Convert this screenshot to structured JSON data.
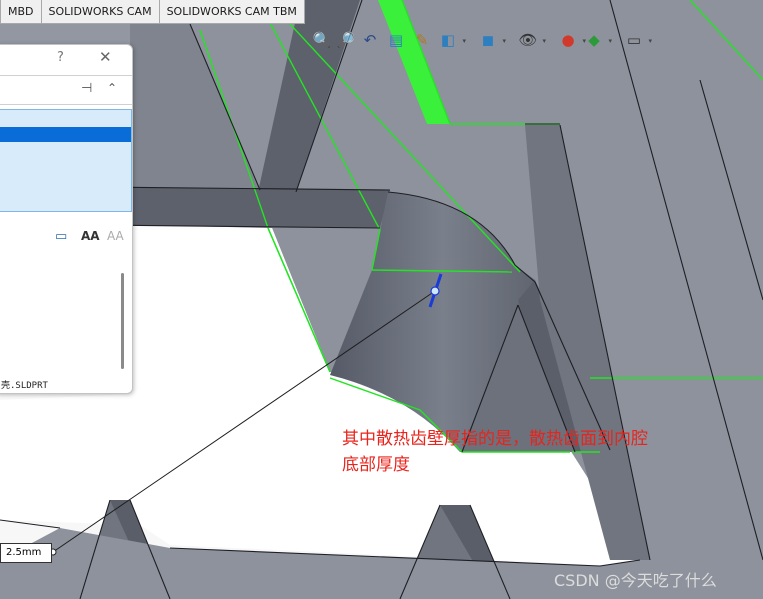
{
  "tabs": [
    {
      "label": "MBD"
    },
    {
      "label": "SOLIDWORKS CAM"
    },
    {
      "label": "SOLIDWORKS CAM TBM"
    }
  ],
  "view_toolbar": {
    "icons": [
      {
        "name": "zoom-to-fit-icon",
        "glyph": "🔍"
      },
      {
        "name": "zoom-to-area-icon",
        "glyph": "🔎"
      },
      {
        "name": "previous-view-icon",
        "glyph": "↶"
      },
      {
        "name": "section-view-icon",
        "glyph": "▤"
      },
      {
        "name": "dynamic-annotation-icon",
        "glyph": "✎"
      },
      {
        "name": "view-orientation-icon",
        "glyph": "◧"
      },
      {
        "name": "display-style-icon",
        "glyph": "◼"
      },
      {
        "name": "hide-show-items-icon",
        "glyph": "👁"
      },
      {
        "name": "edit-appearance-icon",
        "glyph": "●"
      },
      {
        "name": "apply-scene-icon",
        "glyph": "◆"
      },
      {
        "name": "view-settings-icon",
        "glyph": "▭"
      }
    ]
  },
  "panel": {
    "help_glyph": "?",
    "close_glyph": "✕",
    "pin_glyph": "⊣",
    "collapse_glyph": "⌃",
    "filename": "壳.SLDPRT",
    "icons": [
      {
        "name": "dimension-text-icon",
        "glyph": "▭"
      },
      {
        "name": "font-size-icon",
        "glyph": "AA"
      },
      {
        "name": "font-style-icon",
        "glyph": "AA"
      }
    ]
  },
  "annotation": {
    "line1": "其中散热齿壁厚指的是，散热齿面到内腔",
    "line2": "底部厚度"
  },
  "dimension": {
    "value": "2.5mm"
  },
  "watermark": {
    "text": "CSDN @今天吃了什么"
  },
  "colors": {
    "face_dark": "#5f636e",
    "face_mid": "#8a8f9a",
    "face_light": "#9196a0",
    "highlight_edge": "#22e522",
    "highlight_face": "#3bf03b",
    "annotation_text": "#e8241d",
    "selection": "#0a6cd6"
  }
}
